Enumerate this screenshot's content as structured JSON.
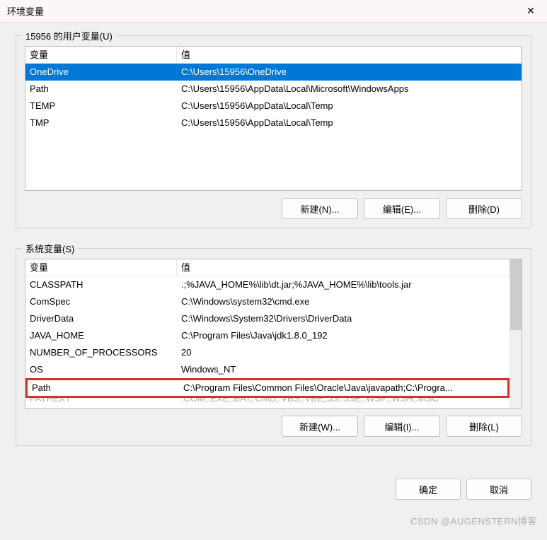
{
  "window": {
    "title": "环境变量",
    "close_glyph": "✕"
  },
  "user_group": {
    "title": "15956 的用户变量(U)",
    "header_var": "变量",
    "header_val": "值",
    "rows": [
      {
        "var": "OneDrive",
        "val": "C:\\Users\\15956\\OneDrive"
      },
      {
        "var": "Path",
        "val": "C:\\Users\\15956\\AppData\\Local\\Microsoft\\WindowsApps"
      },
      {
        "var": "TEMP",
        "val": "C:\\Users\\15956\\AppData\\Local\\Temp"
      },
      {
        "var": "TMP",
        "val": "C:\\Users\\15956\\AppData\\Local\\Temp"
      }
    ],
    "buttons": {
      "new": "新建(N)...",
      "edit": "编辑(E)...",
      "delete": "删除(D)"
    }
  },
  "system_group": {
    "title": "系统变量(S)",
    "header_var": "变量",
    "header_val": "值",
    "rows": [
      {
        "var": "CLASSPATH",
        "val": ".;%JAVA_HOME%\\lib\\dt.jar;%JAVA_HOME%\\lib\\tools.jar"
      },
      {
        "var": "ComSpec",
        "val": "C:\\Windows\\system32\\cmd.exe"
      },
      {
        "var": "DriverData",
        "val": "C:\\Windows\\System32\\Drivers\\DriverData"
      },
      {
        "var": "JAVA_HOME",
        "val": "C:\\Program Files\\Java\\jdk1.8.0_192"
      },
      {
        "var": "NUMBER_OF_PROCESSORS",
        "val": "20"
      },
      {
        "var": "OS",
        "val": "Windows_NT"
      },
      {
        "var": "Path",
        "val": "C:\\Program Files\\Common Files\\Oracle\\Java\\javapath;C:\\Progra..."
      },
      {
        "var": "PATHEXT",
        "val": ".COM;.EXE;.BAT;.CMD;.VBS;.VBE;.JS;.JSE;.WSF;.WSH;.MSC"
      }
    ],
    "buttons": {
      "new": "新建(W)...",
      "edit": "编辑(I)...",
      "delete": "删除(L)"
    }
  },
  "dialog_buttons": {
    "ok": "确定",
    "cancel": "取消"
  },
  "watermark": "CSDN @AUGENSTERN博客"
}
